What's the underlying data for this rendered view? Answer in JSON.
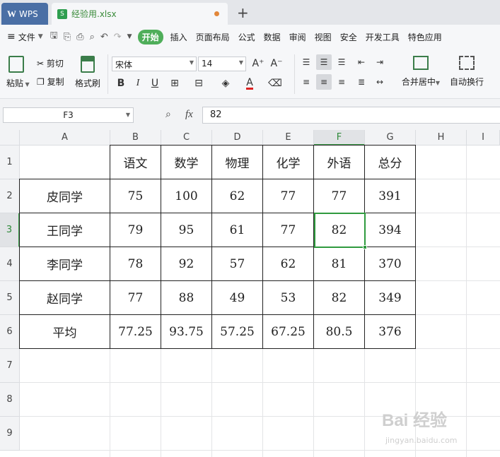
{
  "titlebar": {
    "app_tab": "WPS",
    "app_logo": "W",
    "file_tab": "经验用.xlsx",
    "new_tab": "+"
  },
  "menubar": {
    "file_menu": "文件",
    "tabs": [
      "开始",
      "插入",
      "页面布局",
      "公式",
      "数据",
      "审阅",
      "视图",
      "安全",
      "开发工具",
      "特色应用"
    ],
    "active_tab": "开始"
  },
  "ribbon": {
    "paste": "粘贴",
    "cut": "剪切",
    "copy": "复制",
    "format_painter": "格式刷",
    "font_name": "宋体",
    "font_size": "14",
    "merge_center": "合并居中",
    "wrap_text": "自动换行"
  },
  "formula_bar": {
    "name_box": "F3",
    "fx": "fx",
    "value": "82"
  },
  "grid": {
    "columns": [
      "A",
      "B",
      "C",
      "D",
      "E",
      "F",
      "G",
      "H",
      "I"
    ],
    "rows": [
      "1",
      "2",
      "3",
      "4",
      "5",
      "6",
      "7",
      "8",
      "9"
    ],
    "selected_column": "F",
    "selected_row": "3",
    "table": [
      [
        "",
        "语文",
        "数学",
        "物理",
        "化学",
        "外语",
        "总分"
      ],
      [
        "皮同学",
        "75",
        "100",
        "62",
        "77",
        "77",
        "391"
      ],
      [
        "王同学",
        "79",
        "95",
        "61",
        "77",
        "82",
        "394"
      ],
      [
        "李同学",
        "78",
        "92",
        "57",
        "62",
        "81",
        "370"
      ],
      [
        "赵同学",
        "77",
        "88",
        "49",
        "53",
        "82",
        "349"
      ],
      [
        "平均",
        "77.25",
        "93.75",
        "57.25",
        "67.25",
        "80.5",
        "376"
      ]
    ]
  },
  "watermark": {
    "logo": "Bai 经验",
    "url": "jingyan.baidu.com"
  },
  "colors": {
    "accent": "#4fae5a",
    "selection": "#2f9a3e",
    "title_tab": "#4a6fa5"
  }
}
